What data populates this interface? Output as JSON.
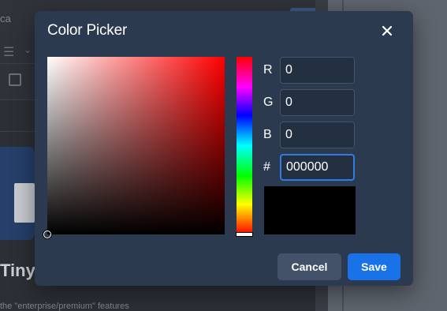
{
  "background": {
    "tab_text": "ca",
    "logo_word": "Tiny",
    "bottom_text": "the \"enterprise/premium\" features"
  },
  "dialog": {
    "title": "Color Picker",
    "close_icon": "close-icon",
    "current_color": "#000000",
    "channels": {
      "r_label": "R",
      "r_value": "0",
      "g_label": "G",
      "g_value": "0",
      "b_label": "B",
      "b_value": "0",
      "hex_label": "#",
      "hex_value": "000000"
    },
    "buttons": {
      "cancel": "Cancel",
      "save": "Save"
    }
  },
  "colors": {
    "dialog_bg": "#2b3a4e",
    "accent": "#1972e8",
    "cancel_bg": "#435268"
  }
}
